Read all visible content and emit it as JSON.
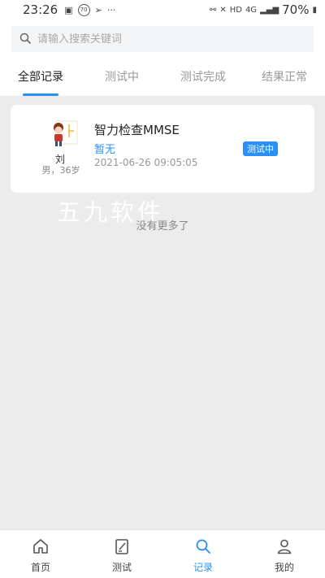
{
  "status_bar": {
    "time": "23:26",
    "badge": "70",
    "network": "4G",
    "hd": "HD",
    "battery": "70%"
  },
  "search": {
    "placeholder": "请输入搜索关键词",
    "icon": "search-icon"
  },
  "tabs": [
    {
      "label": "全部记录",
      "active": true
    },
    {
      "label": "测试中",
      "active": false
    },
    {
      "label": "测试完成",
      "active": false
    },
    {
      "label": "结果正常",
      "active": false
    }
  ],
  "records": [
    {
      "patient_name": "刘",
      "patient_info": "男，36岁",
      "test_name": "智力检查MMSE",
      "result": "暂无",
      "time": "2021-06-26 09:05:05",
      "status": "测试中"
    }
  ],
  "watermark": "五九软件",
  "empty_hint": "没有更多了",
  "bottom_nav": [
    {
      "label": "首页",
      "icon": "home-icon",
      "active": false
    },
    {
      "label": "测试",
      "icon": "test-icon",
      "active": false
    },
    {
      "label": "记录",
      "icon": "search-icon",
      "active": true
    },
    {
      "label": "我的",
      "icon": "user-icon",
      "active": false
    }
  ],
  "colors": {
    "accent": "#2a8ff7",
    "background": "#ececec"
  }
}
